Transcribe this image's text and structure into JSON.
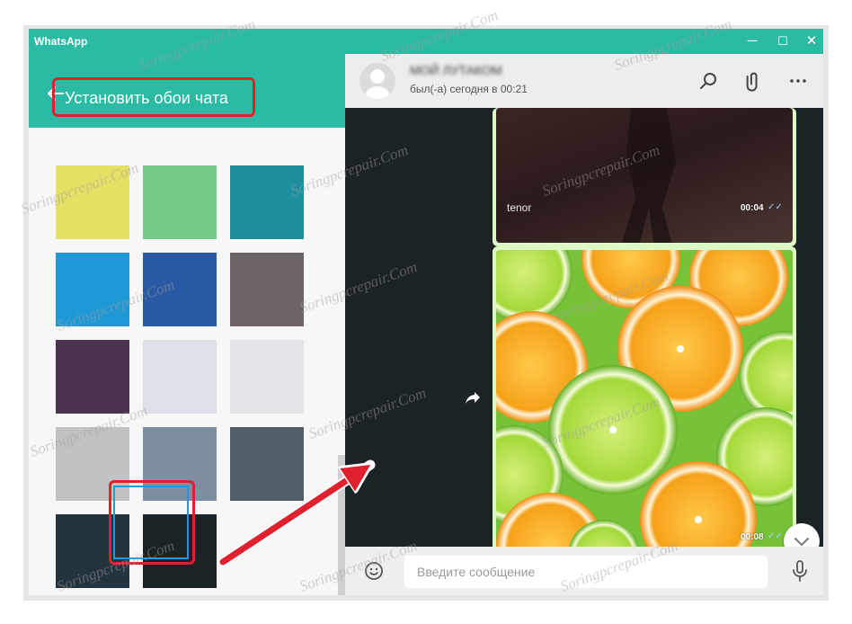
{
  "window": {
    "app_title": "WhatsApp",
    "controls": {
      "minimize": "─",
      "maximize": "☐",
      "close": "✕"
    }
  },
  "wallpaper_panel": {
    "title": "Установить обои чата",
    "swatches": [
      "#e6e064",
      "#73c985",
      "#1f8fa0",
      "#1f99d6",
      "#2a5aa5",
      "#6e6566",
      "#4a344d",
      "#dde1e7",
      "#e3e5e8",
      "#c1c2c4",
      "#7f8fa3",
      "#515e66",
      "#24343e",
      "#1b2326"
    ],
    "selected_swatch": 13
  },
  "chat": {
    "contact_name": "МОЙ ЛУТАКОМ",
    "status": "был(-а) сегодня в 00:21",
    "messages": [
      {
        "caption": "tenor",
        "time": "00:04",
        "ticks": "✓✓"
      },
      {
        "time": "00:08",
        "ticks": "✓✓"
      }
    ],
    "input_placeholder": "Введите сообщение"
  },
  "colors": {
    "accent": "#2bbba4",
    "highlight": "#e0202c",
    "chat_background": "#1c2326",
    "outgoing_bubble": "#dcf8c6"
  },
  "watermark": "Soringpcrepair.Com"
}
